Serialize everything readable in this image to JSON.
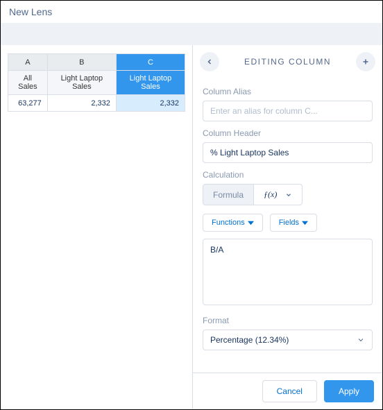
{
  "header": {
    "title": "New Lens"
  },
  "table": {
    "cols": [
      {
        "letter": "A",
        "header": "All Sales",
        "value": "63,277",
        "selected": false
      },
      {
        "letter": "B",
        "header": "Light Laptop Sales",
        "value": "2,332",
        "selected": false
      },
      {
        "letter": "C",
        "header": "Light Laptop Sales",
        "value": "2,332",
        "selected": true
      }
    ]
  },
  "panel": {
    "title": "EDITING COLUMN",
    "alias_label": "Column Alias",
    "alias_placeholder": "Enter an alias for column C...",
    "alias_value": "",
    "header_label": "Column Header",
    "header_value": "% Light Laptop Sales",
    "calc_label": "Calculation",
    "calc_formula_label": "Formula",
    "calc_fx_label": "ƒ(x)",
    "functions_label": "Functions",
    "fields_label": "Fields",
    "formula_value": "B/A",
    "format_label": "Format",
    "format_value": "Percentage (12.34%)",
    "cancel_label": "Cancel",
    "apply_label": "Apply"
  }
}
